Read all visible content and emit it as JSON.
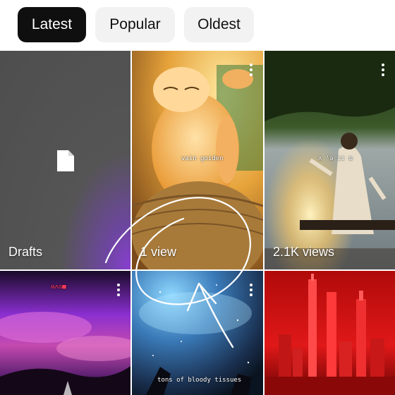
{
  "filters": {
    "latest": "Latest",
    "popular": "Popular",
    "oldest": "Oldest",
    "active": "Latest"
  },
  "grid": {
    "tiles": [
      {
        "label": "Drafts",
        "icon": "document-icon"
      },
      {
        "label": "1 view",
        "caption": "vain goiden"
      },
      {
        "label": "2.1K views",
        "caption": "ʌ 'ə ɪɪ ɯ"
      },
      {
        "label": "",
        "caption": "ʍʌ◎■"
      },
      {
        "label": "",
        "caption": "tons of bloody tissues"
      },
      {
        "label": "",
        "caption": ""
      }
    ]
  },
  "colors": {
    "chip_active_bg": "#0f0f0f",
    "chip_bg": "#f2f2f2",
    "annotation_stroke": "#ffffff"
  }
}
